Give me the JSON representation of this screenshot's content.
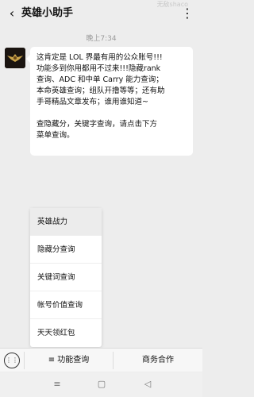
{
  "header": {
    "title": "英雄小助手",
    "watermark": "无敌shaco",
    "back_icon": "back-arrow-icon",
    "more_icon": "more-dots-icon"
  },
  "chat": {
    "timestamp": "晚上7:34",
    "message_paragraph_1": "这肯定是 LOL 界最有用的公众账号!!!\n功能多到你用都用不过来!!!隐藏rank\n查询、ADC 和中单 Carry 能力查询；\n本命英雄查询；组队开撸等等；还有助\n手哥精品文章发布；谁用谁知道~",
    "message_paragraph_2": "查隐藏分，关键字查询，请点击下方\n菜单查询。"
  },
  "menu": {
    "items": [
      {
        "label": "英雄战力"
      },
      {
        "label": "隐藏分查询"
      },
      {
        "label": "关键词查询"
      },
      {
        "label": "帐号价值查询"
      },
      {
        "label": "天天领红包"
      }
    ]
  },
  "bottom_bar": {
    "keyboard_icon": "keyboard-icon",
    "tab_function": "≡ 功能查询",
    "tab_business": "商务合作"
  },
  "nav": {
    "menu_icon": "menu-icon",
    "home_icon": "home-square-icon",
    "back_icon": "back-triangle-icon"
  },
  "colors": {
    "background": "#ededed",
    "bubble": "#ffffff",
    "menu_active": "#ececec"
  }
}
